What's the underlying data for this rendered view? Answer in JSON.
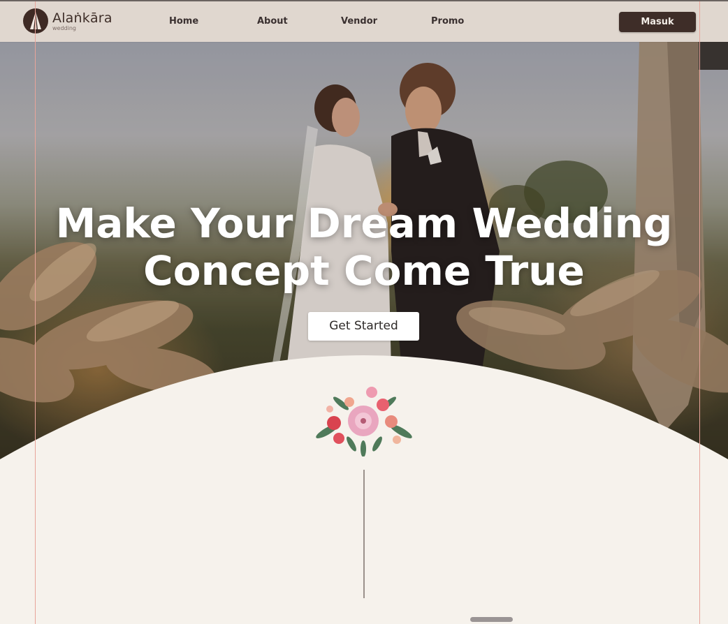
{
  "brand": {
    "name": "Alaṅkāra",
    "tagline": "wedding"
  },
  "nav": {
    "links": [
      "Home",
      "About",
      "Vendor",
      "Promo"
    ],
    "login_label": "Masuk"
  },
  "hero": {
    "title_line1": "Make Your Dream Wedding",
    "title_line2": "Concept Come True",
    "cta_label": "Get Started"
  },
  "colors": {
    "nav_bg": "#e0d7cf",
    "brand_dark": "#3e2d28",
    "page_bg": "#f6f2ec",
    "accent_pink": "#e8a49a"
  },
  "icons": {
    "logo": "logo-mark-icon",
    "flower": "flower-bouquet-icon"
  }
}
